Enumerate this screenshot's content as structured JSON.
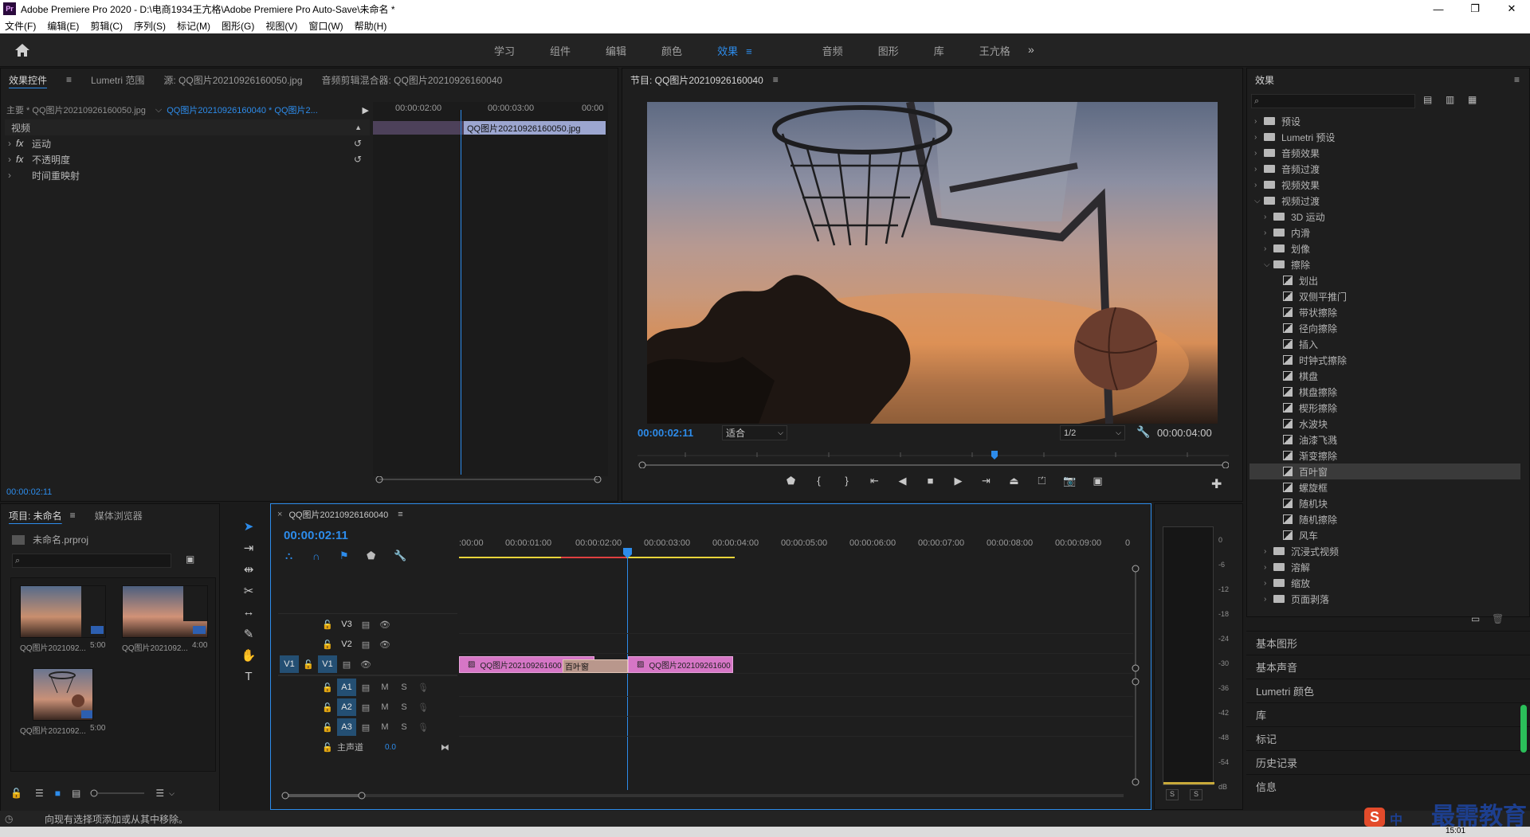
{
  "window": {
    "title": "Adobe Premiere Pro 2020 - D:\\电商1934王亢格\\Adobe Premiere Pro Auto-Save\\未命名 *",
    "logo": "Pr",
    "minimize": "—",
    "maximize": "❐",
    "close": "✕"
  },
  "menu": [
    "文件(F)",
    "编辑(E)",
    "剪辑(C)",
    "序列(S)",
    "标记(M)",
    "图形(G)",
    "视图(V)",
    "窗口(W)",
    "帮助(H)"
  ],
  "workspaces": {
    "tabs": [
      "学习",
      "组件",
      "编辑",
      "颜色",
      "效果",
      "音频",
      "图形",
      "库",
      "王亢格"
    ],
    "active_index": 4,
    "more": "»"
  },
  "effect_controls": {
    "tabs": [
      "效果控件",
      "Lumetri 范围",
      "源: QQ图片20210926160050.jpg",
      "音频剪辑混合器: QQ图片20210926160040"
    ],
    "master": "主要 * QQ图片20210926160050.jpg",
    "sequence_clip": "QQ图片20210926160040 * QQ图片2...",
    "section": "视频",
    "effects": [
      {
        "icon": "fx",
        "name": "运动"
      },
      {
        "icon": "fx",
        "name": "不透明度"
      },
      {
        "icon": "",
        "name": "时间重映射"
      }
    ],
    "ruler": [
      "00:00:02:00",
      "00:00:03:00",
      "00:00"
    ],
    "clip_label": "QQ图片20210926160050.jpg",
    "current_time": "00:00:02:11"
  },
  "program_monitor": {
    "title": "节目: QQ图片20210926160040",
    "current_time": "00:00:02:11",
    "fit": "适合",
    "resolution": "1/2",
    "duration": "00:00:04:00"
  },
  "effects_panel": {
    "title": "效果",
    "tree": [
      {
        "label": "预设",
        "type": "folder",
        "depth": 0,
        "open": false
      },
      {
        "label": "Lumetri 预设",
        "type": "folder",
        "depth": 0,
        "open": false
      },
      {
        "label": "音频效果",
        "type": "folder",
        "depth": 0,
        "open": false
      },
      {
        "label": "音频过渡",
        "type": "folder",
        "depth": 0,
        "open": false
      },
      {
        "label": "视频效果",
        "type": "folder",
        "depth": 0,
        "open": false
      },
      {
        "label": "视频过渡",
        "type": "folder",
        "depth": 0,
        "open": true
      },
      {
        "label": "3D 运动",
        "type": "folder",
        "depth": 1,
        "open": false
      },
      {
        "label": "内滑",
        "type": "folder",
        "depth": 1,
        "open": false
      },
      {
        "label": "划像",
        "type": "folder",
        "depth": 1,
        "open": false
      },
      {
        "label": "擦除",
        "type": "folder",
        "depth": 1,
        "open": true
      },
      {
        "label": "划出",
        "type": "fx",
        "depth": 2
      },
      {
        "label": "双侧平推门",
        "type": "fx",
        "depth": 2
      },
      {
        "label": "带状擦除",
        "type": "fx",
        "depth": 2
      },
      {
        "label": "径向擦除",
        "type": "fx",
        "depth": 2
      },
      {
        "label": "插入",
        "type": "fx",
        "depth": 2
      },
      {
        "label": "时钟式擦除",
        "type": "fx",
        "depth": 2
      },
      {
        "label": "棋盘",
        "type": "fx",
        "depth": 2
      },
      {
        "label": "棋盘擦除",
        "type": "fx",
        "depth": 2
      },
      {
        "label": "楔形擦除",
        "type": "fx",
        "depth": 2
      },
      {
        "label": "水波块",
        "type": "fx",
        "depth": 2
      },
      {
        "label": "油漆飞溅",
        "type": "fx",
        "depth": 2
      },
      {
        "label": "渐变擦除",
        "type": "fx",
        "depth": 2
      },
      {
        "label": "百叶窗",
        "type": "fx",
        "depth": 2,
        "selected": true
      },
      {
        "label": "螺旋框",
        "type": "fx",
        "depth": 2
      },
      {
        "label": "随机块",
        "type": "fx",
        "depth": 2
      },
      {
        "label": "随机擦除",
        "type": "fx",
        "depth": 2
      },
      {
        "label": "风车",
        "type": "fx",
        "depth": 2
      },
      {
        "label": "沉浸式视频",
        "type": "folder",
        "depth": 1,
        "open": false
      },
      {
        "label": "溶解",
        "type": "folder",
        "depth": 1,
        "open": false
      },
      {
        "label": "缩放",
        "type": "folder",
        "depth": 1,
        "open": false
      },
      {
        "label": "页面剥落",
        "type": "folder",
        "depth": 1,
        "open": false
      }
    ],
    "side_tabs": [
      "基本图形",
      "基本声音",
      "Lumetri 颜色",
      "库",
      "标记",
      "历史记录",
      "信息"
    ]
  },
  "project": {
    "tabs": [
      "项目: 未命名",
      "媒体浏览器"
    ],
    "file": "未命名.prproj",
    "items": [
      {
        "name": "QQ图片2021092...",
        "duration": "5:00"
      },
      {
        "name": "QQ图片2021092...",
        "duration": "4:00"
      },
      {
        "name": "QQ图片2021092...",
        "duration": "5:00"
      }
    ]
  },
  "timeline": {
    "title": "QQ图片20210926160040",
    "close": "×",
    "current_time": "00:00:02:11",
    "ruler": [
      ":00:00",
      "00:00:01:00",
      "00:00:02:00",
      "00:00:03:00",
      "00:00:04:00",
      "00:00:05:00",
      "00:00:06:00",
      "00:00:07:00",
      "00:00:08:00",
      "00:00:09:00",
      "0"
    ],
    "video_tracks": [
      "V3",
      "V2",
      "V1"
    ],
    "audio_tracks": [
      "A1",
      "A2",
      "A3"
    ],
    "source_v": "V1",
    "master": "主声道",
    "master_value": "0.0",
    "clip1": "QQ图片202109261600",
    "clip2": "QQ图片202109261600",
    "transition": "百叶窗",
    "m": "M",
    "s": "S"
  },
  "meter": {
    "scale": [
      "0",
      "-6",
      "-12",
      "-18",
      "-24",
      "-30",
      "-36",
      "-42",
      "-48",
      "-54",
      "dB"
    ],
    "solo": "S"
  },
  "status": "向现有选择项添加或从其中移除。",
  "watermark": "最需教育",
  "watermark_badge": "S",
  "watermark_suffix": "中",
  "clock": "15:01"
}
